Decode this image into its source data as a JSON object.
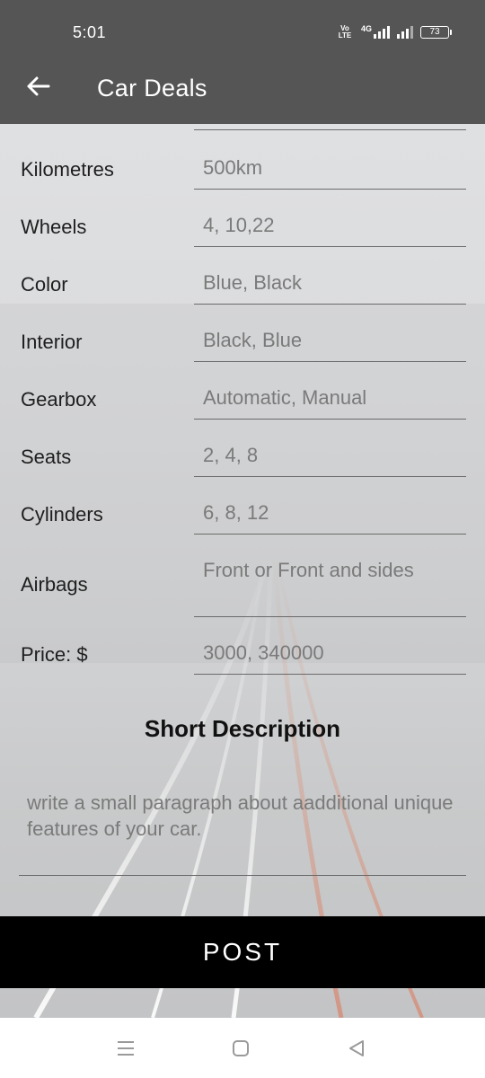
{
  "status_bar": {
    "time": "5:01",
    "volte": "Vo LTE",
    "network": "4G",
    "battery": "73"
  },
  "app_bar": {
    "title": "Car Deals"
  },
  "form": {
    "rows": [
      {
        "label": "Kilometres",
        "placeholder": "500km"
      },
      {
        "label": "Wheels",
        "placeholder": "4, 10,22"
      },
      {
        "label": "Color",
        "placeholder": "Blue, Black"
      },
      {
        "label": "Interior",
        "placeholder": "Black, Blue"
      },
      {
        "label": "Gearbox",
        "placeholder": "Automatic, Manual"
      },
      {
        "label": "Seats",
        "placeholder": "2, 4, 8"
      },
      {
        "label": "Cylinders",
        "placeholder": "6, 8, 12"
      },
      {
        "label": "Airbags",
        "placeholder": "Front or Front and sides"
      },
      {
        "label": "Price: $",
        "placeholder": "3000, 340000"
      }
    ],
    "description_title": "Short Description",
    "description_placeholder": "write a small paragraph about aadditional unique features of your car.",
    "post_label": "POST"
  },
  "colors": {
    "app_bar": "#555555",
    "post_button": "#000000"
  },
  "icons": {
    "back": "arrow-left-icon",
    "nav_recent": "menu-lines-icon",
    "nav_home": "square-icon",
    "nav_back": "triangle-back-icon"
  }
}
